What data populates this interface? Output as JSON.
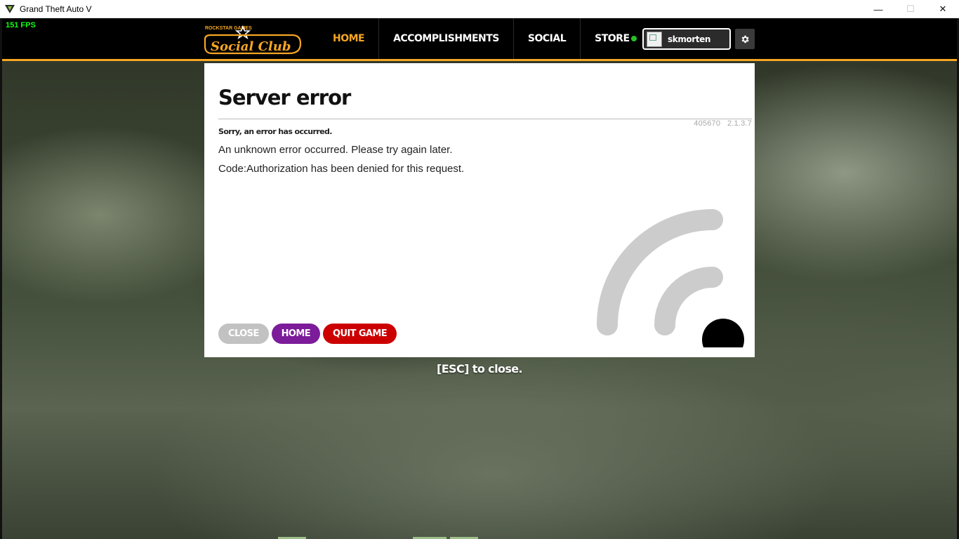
{
  "window": {
    "title": "Grand Theft Auto V",
    "minimize_glyph": "—",
    "maximize_glyph": "☐",
    "close_glyph": "✕"
  },
  "overlay": {
    "fps": "151 FPS"
  },
  "nav": {
    "logo_icon": "social-club-logo",
    "logo_small_text": "ROCKSTAR GAMES",
    "logo_text": "Social Club",
    "items": [
      {
        "label": "HOME",
        "active": true
      },
      {
        "label": "ACCOMPLISHMENTS",
        "active": false
      },
      {
        "label": "SOCIAL",
        "active": false
      },
      {
        "label": "STORE",
        "active": false
      }
    ],
    "status_color": "#25c025",
    "username": "skmorten",
    "settings_icon": "gear-icon",
    "accent_color": "#f5a623"
  },
  "error_panel": {
    "title": "Server error",
    "version_id": "405670",
    "version_number": "2.1.3.7",
    "subtitle": "Sorry, an error has occurred.",
    "message": "An unknown error occurred. Please try again later.",
    "code": "Code:Authorization has been denied for this request.",
    "illustration_icon": "no-connection-wifi-icon",
    "buttons": {
      "close": "CLOSE",
      "home": "HOME",
      "quit": "QUIT GAME"
    }
  },
  "esc_hint": "[ESC] to close."
}
